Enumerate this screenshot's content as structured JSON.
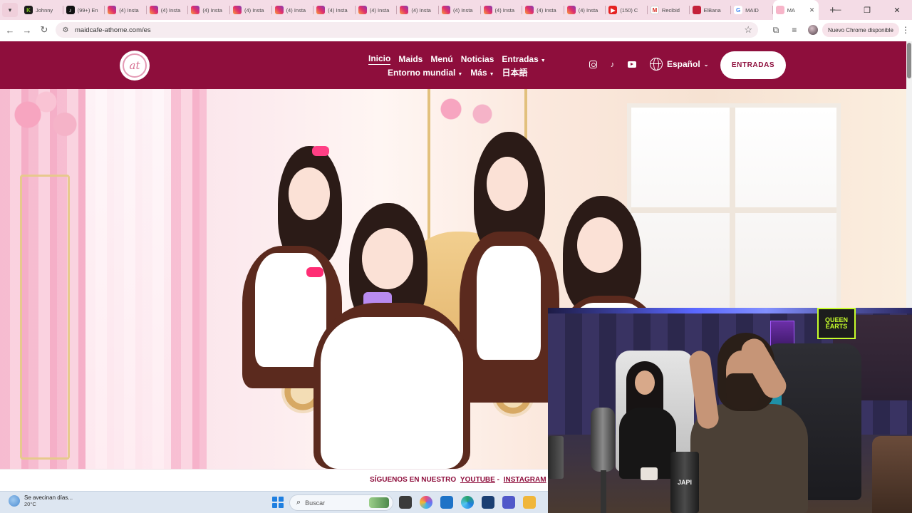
{
  "browser": {
    "tabs": [
      {
        "title": "Johnny",
        "icon": "kick-icon"
      },
      {
        "title": "(99+) En",
        "icon": "tiktok-icon"
      },
      {
        "title": "(4) Insta",
        "icon": "instagram-icon"
      },
      {
        "title": "(4) Insta",
        "icon": "instagram-icon"
      },
      {
        "title": "(4) Insta",
        "icon": "instagram-icon"
      },
      {
        "title": "(4) Insta",
        "icon": "instagram-icon"
      },
      {
        "title": "(4) Insta",
        "icon": "instagram-icon"
      },
      {
        "title": "(4) Insta",
        "icon": "instagram-icon"
      },
      {
        "title": "(4) Insta",
        "icon": "instagram-icon"
      },
      {
        "title": "(4) Insta",
        "icon": "instagram-icon"
      },
      {
        "title": "(4) Insta",
        "icon": "instagram-icon"
      },
      {
        "title": "(4) Insta",
        "icon": "instagram-icon"
      },
      {
        "title": "(4) Insta",
        "icon": "instagram-icon"
      },
      {
        "title": "(4) Insta",
        "icon": "instagram-icon"
      },
      {
        "title": "(150) C",
        "icon": "youtube-icon"
      },
      {
        "title": "Recibid",
        "icon": "gmail-icon"
      },
      {
        "title": "ElBana",
        "icon": "site-icon"
      },
      {
        "title": "MAID",
        "icon": "google-icon"
      }
    ],
    "active_tab": {
      "title": "MA",
      "icon": "maidcafe-icon"
    },
    "new_tab_label": "+",
    "url": "maidcafe-athome.com/es",
    "update_label": "Nuevo Chrome disponible"
  },
  "site": {
    "brand_color": "#8e0e3c",
    "logo_text": "at",
    "nav_row1": [
      "Inicio",
      "Maids",
      "Menú",
      "Noticias",
      "Entradas"
    ],
    "nav_row2": [
      "Entorno mundial",
      "Más",
      "日本語"
    ],
    "language": "Español",
    "cta_label": "ENTRADAS",
    "follow": {
      "prefix": "SÍGUENOS EN NUESTRO",
      "youtube": "YOUTUBE",
      "separator": "-",
      "instagram": "INSTAGRAM",
      "heart": "♡"
    }
  },
  "taskbar": {
    "weather_text": "Se avecinan días...",
    "temperature": "20°C",
    "search_placeholder": "Buscar"
  },
  "webcam": {
    "poster_text": "QUEEN EARTS",
    "can_text": "JAPI"
  }
}
